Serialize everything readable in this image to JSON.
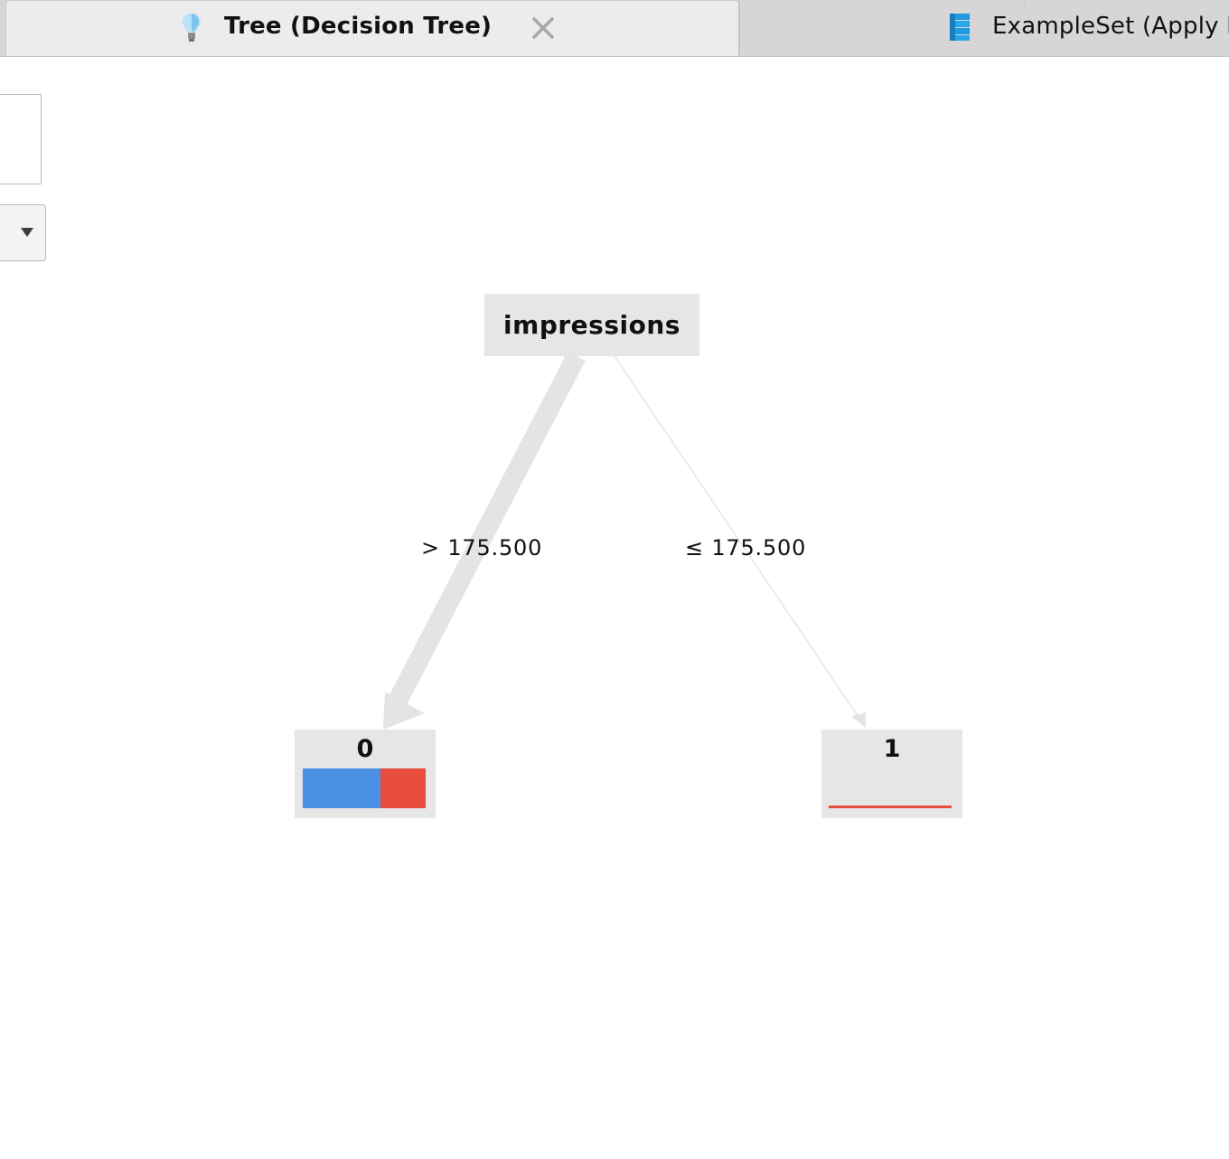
{
  "tabs": {
    "active": {
      "label": "Tree (Decision Tree)",
      "icon": "lightbulb-icon"
    },
    "inactive": {
      "label": "ExampleSet (Apply M",
      "icon": "database-icon"
    }
  },
  "tree": {
    "root": {
      "label": "impressions"
    },
    "edges": [
      {
        "label": "> 175.500"
      },
      {
        "label": "≤ 175.500"
      }
    ],
    "leaves": [
      {
        "label": "0",
        "class_distribution": [
          0.63,
          0.37
        ]
      },
      {
        "label": "1",
        "class_distribution": [
          0.0,
          1.0
        ]
      }
    ]
  },
  "colors": {
    "class_a": "#4a8fe2",
    "class_b": "#e84c3d",
    "node_bg": "#e6e6e6",
    "edge": "#e4e4e4"
  }
}
